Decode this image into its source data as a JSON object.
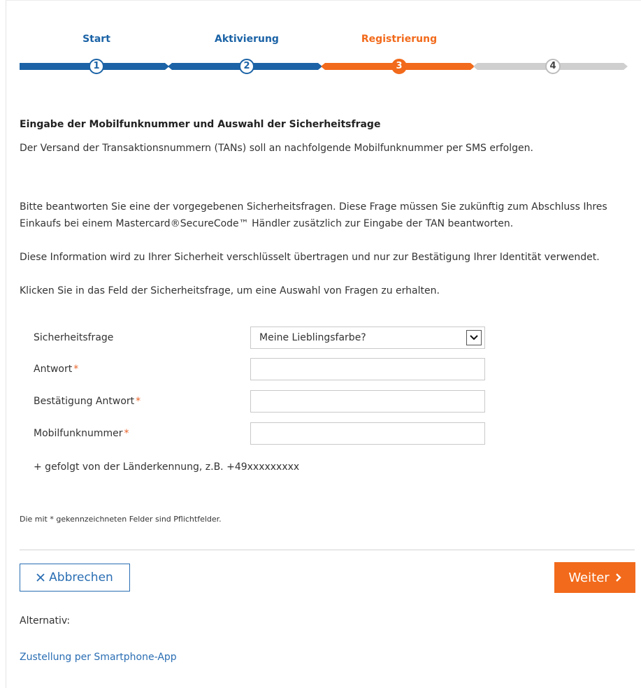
{
  "stepper": {
    "steps": [
      {
        "label": "Start",
        "number": "1",
        "state": "done",
        "color": "#1b63a6"
      },
      {
        "label": "Aktivierung",
        "number": "2",
        "state": "done",
        "color": "#1b63a6"
      },
      {
        "label": "Registrierung",
        "number": "3",
        "state": "active",
        "color": "#f26a1b"
      },
      {
        "label": "",
        "number": "4",
        "state": "upcoming",
        "color": "#cfcfcf"
      }
    ]
  },
  "content": {
    "heading": "Eingabe der Mobilfunknummer und Auswahl der Sicherheitsfrage",
    "para1": "Der Versand der Transaktionsnummern (TANs) soll an nachfolgende Mobilfunknummer per SMS erfolgen.",
    "para2_line1": "Bitte beantworten Sie eine der vorgegebenen Sicherheitsfragen. Diese Frage müssen Sie zukünftig zum Abschluss Ihres Einkaufs bei einem Mastercard®SecureCode™ Händler zusätzlich zur Eingabe der TAN beantworten.",
    "para2_line2": "Diese Information wird zu Ihrer Sicherheit verschlüsselt übertragen und nur zur Bestätigung Ihrer Identität verwendet.",
    "para2_line3": "Klicken Sie in das Feld der Sicherheitsfrage, um eine Auswahl von Fragen zu erhalten."
  },
  "form": {
    "security_question_label": "Sicherheitsfrage",
    "security_question_value": "Meine Lieblingsfarbe?",
    "answer_label": "Antwort",
    "answer_value": "",
    "confirm_answer_label": "Bestätigung Antwort",
    "confirm_answer_value": "",
    "mobile_label": "Mobilfunknummer",
    "mobile_value": "",
    "required_marker": "*",
    "hint": "+ gefolgt von der Länderkennung, z.B. +49xxxxxxxxx"
  },
  "footnote": "Die mit * gekennzeichneten Felder sind Pflichtfelder.",
  "buttons": {
    "cancel_label": "Abbrechen",
    "cancel_icon": "close-icon",
    "next_label": "Weiter",
    "next_icon": "chevron-right-icon"
  },
  "alternative": {
    "label": "Alternativ:",
    "link": "Zustellung per Smartphone-App"
  },
  "colors": {
    "primary_blue": "#1b63a6",
    "accent_orange": "#f26a1b",
    "inactive_grey": "#cfcfcf",
    "link_blue": "#2a6eb3"
  }
}
